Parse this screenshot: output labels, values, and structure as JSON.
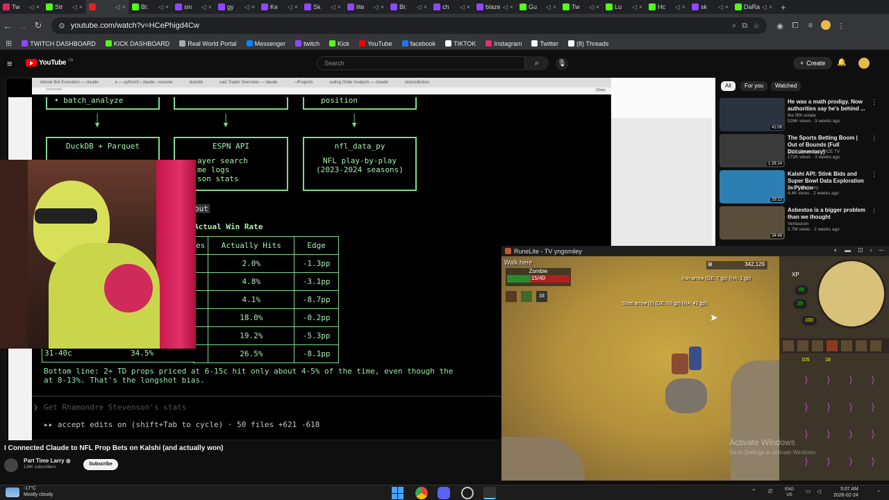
{
  "browser": {
    "tabs": [
      {
        "label": "Tw",
        "color": "#e0245e"
      },
      {
        "label": "Str",
        "color": "#53fc18"
      },
      {
        "label": "",
        "color": "#e62117"
      },
      {
        "label": "Bi:",
        "color": "#53fc18"
      },
      {
        "label": "sin",
        "color": "#9146ff"
      },
      {
        "label": "gy",
        "color": "#9146ff"
      },
      {
        "label": "Ke",
        "color": "#9146ff"
      },
      {
        "label": "Sk",
        "color": "#9146ff"
      },
      {
        "label": "lite",
        "color": "#9146ff"
      },
      {
        "label": "Bi:",
        "color": "#9146ff"
      },
      {
        "label": "ch",
        "color": "#9146ff"
      },
      {
        "label": "blaze",
        "color": "#9146ff"
      },
      {
        "label": "Gu",
        "color": "#53fc18"
      },
      {
        "label": "Tw",
        "color": "#53fc18"
      },
      {
        "label": "Lu",
        "color": "#53fc18"
      },
      {
        "label": "Hc",
        "color": "#53fc18"
      },
      {
        "label": "sk",
        "color": "#9146ff"
      },
      {
        "label": "DaRa",
        "color": "#53fc18"
      }
    ],
    "url": "youtube.com/watch?v=HCePhigd4Cw",
    "bookmarks": [
      {
        "label": "TWITCH DASHBOARD",
        "color": "#9146ff"
      },
      {
        "label": "KICK DASHBOARD",
        "color": "#53fc18"
      },
      {
        "label": "Real World Portal",
        "color": "#aaaaaa"
      },
      {
        "label": "Messenger",
        "color": "#0084ff"
      },
      {
        "label": "twitch",
        "color": "#9146ff"
      },
      {
        "label": "Kick",
        "color": "#53fc18"
      },
      {
        "label": "YouTube",
        "color": "#ff0000"
      },
      {
        "label": "facebook",
        "color": "#1877f2"
      },
      {
        "label": "TIKTOK",
        "color": "#ffffff"
      },
      {
        "label": "Instagram",
        "color": "#e1306c"
      },
      {
        "label": "Twitter",
        "color": "#ffffff"
      },
      {
        "label": "(8) Threads",
        "color": "#ffffff"
      }
    ]
  },
  "youtube": {
    "logo": "YouTube",
    "logo_region": "CA",
    "search_placeholder": "Search",
    "create_label": "Create",
    "video_title": "I Connected Claude to NFL Prop Bets on Kalshi (and actually won)",
    "channel_name": "Part Time Larry",
    "subscribers": "136K subscribers",
    "subscribe_label": "Subscribe",
    "chips": [
      "All",
      "For you",
      "Watched"
    ],
    "recommendations": [
      {
        "title": "He was a math prodigy. Now authorities say he's behind ...",
        "channel": "the fifth estate",
        "meta": "528K views · 3 weeks ago",
        "duration": "41:09",
        "thumb": "#2a3440"
      },
      {
        "title": "The Sports Betting Boom | Out of Bounds (Full Documentary)",
        "channel": "VICE Sports and VICE TV",
        "meta": "172K views · 3 weeks ago",
        "duration": "1:28:14",
        "thumb": "#3a3a3a"
      },
      {
        "title": "Kalshi API: Stink Bids and Super Bowl Data Exploration in Python",
        "channel": "Part Time Larry",
        "meta": "4.4K views · 2 weeks ago",
        "duration": "29:12",
        "thumb": "#2c7fb0"
      },
      {
        "title": "Asbestos is a bigger problem than we thought",
        "channel": "Veritasium",
        "meta": "5.7M views · 2 weeks ago",
        "duration": "34:46",
        "thumb": "#5b4d3c"
      }
    ]
  },
  "terminal": {
    "tab_labels": [
      "tebook Bot Execution — claude",
      "e — python3 ‹ claude --resume",
      "duckdb",
      "cast Trader Overview — claude",
      "~/Projects",
      "rading Order Analysis — claude",
      "zerprediction-"
    ],
    "url_label": "connected",
    "done_label": "Done",
    "box_top_left": "• batch_analyze",
    "box_top_right": "position",
    "box_duckdb": "DuckDB + Parquet",
    "box_espn_title": "ESPN API",
    "box_espn_lines": [
      "ayer search",
      "me logs",
      "son stats"
    ],
    "box_nfl_title": "nfl_data_py",
    "box_nfl_lines": [
      "NFL play-by-play",
      "(2023-2024 seasons)"
    ],
    "label_out": "out",
    "heading": "Actual Win Rate",
    "table_headers": [
      "es",
      "Actually Hits",
      "Edge"
    ],
    "table_rows": [
      [
        "",
        "2.0%",
        "-1.3pp"
      ],
      [
        "",
        "4.8%",
        "-3.1pp"
      ],
      [
        "",
        "4.1%",
        "-8.7pp"
      ],
      [
        "",
        "18.0%",
        "-0.2pp"
      ],
      [
        "",
        "19.2%",
        "-5.3pp"
      ],
      [
        "34.5%",
        "26.5%",
        "-8.1pp"
      ]
    ],
    "row_last_range": "31-40c",
    "bottom_line_1": "Bottom line: 2+ TD props priced at 6-15c hit only about 4-5% of the time, even though the",
    "bottom_line_2": "at 8-13%. That's the longshot bias.",
    "prompt_text": "Get Rhamondre Stevenson's stats",
    "status_line": "▸▸ accept edits on (shift+Tab to cycle) · 50 files +621 -618"
  },
  "runelite": {
    "title": "RuneLite - TV yngsmiley",
    "action_text": "Walk here",
    "target_name": "Zombie",
    "target_hp": "15/40",
    "hp_fraction": 0.375,
    "gp_value": "342,129",
    "item_label_1": "Iron arrow (GE: 7 gp) (HA: 1 gp)",
    "item_label_2": "Steel arrow (6) (GE: 78 gp) (HA: 42 gp)",
    "orb_hp": "65",
    "orb_prayer": "29",
    "orb_run": "100",
    "xp_label": "XP",
    "inventory_counts": [
      "105",
      "18"
    ],
    "watermark_1": "Activate Windows",
    "watermark_2": "Go to Settings to activate Windows."
  },
  "taskbar": {
    "weather_temp": "-17°C",
    "weather_desc": "Mostly cloudy",
    "lang_1": "ENG",
    "lang_2": "US",
    "time": "5:07 AM",
    "date": "2026-02-24"
  }
}
